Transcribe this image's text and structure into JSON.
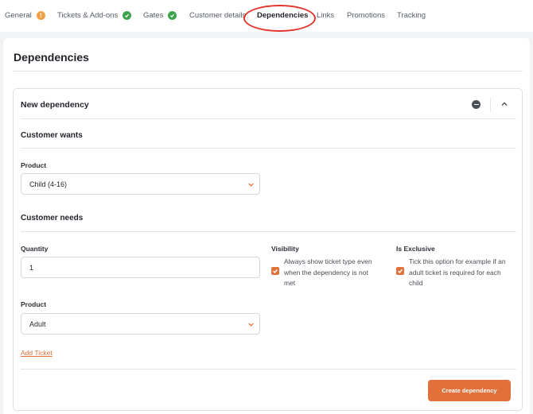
{
  "tabs": [
    {
      "label": "General",
      "status": "warning"
    },
    {
      "label": "Tickets & Add-ons",
      "status": "ok"
    },
    {
      "label": "Gates",
      "status": "ok"
    },
    {
      "label": "Customer details",
      "status": null
    },
    {
      "label": "Dependencies",
      "status": null,
      "active": true
    },
    {
      "label": "Links",
      "status": null
    },
    {
      "label": "Promotions",
      "status": null
    },
    {
      "label": "Tracking",
      "status": null
    }
  ],
  "page": {
    "title": "Dependencies"
  },
  "dependency": {
    "title": "New dependency",
    "customer_wants": {
      "title": "Customer wants",
      "product_label": "Product",
      "product_value": "Child (4-16)"
    },
    "customer_needs": {
      "title": "Customer needs",
      "quantity_label": "Quantity",
      "quantity_value": "1",
      "product_label": "Product",
      "product_value": "Adult",
      "visibility_label": "Visibility",
      "visibility_lines": [
        "Always show ticket type even",
        "when the dependency is not",
        "met"
      ],
      "visibility_checked": true,
      "exclusive_label": "Is Exclusive",
      "exclusive_lines": [
        "Tick this option for example if an",
        "adult ticket is required for each",
        "child"
      ],
      "exclusive_checked": true
    },
    "add_ticket_label": "Add Ticket",
    "create_button_label": "Create dependency"
  },
  "colors": {
    "accent": "#e2703a",
    "ok": "#3fa34d",
    "warning": "#f0a044",
    "annotation": "#e2352b"
  }
}
